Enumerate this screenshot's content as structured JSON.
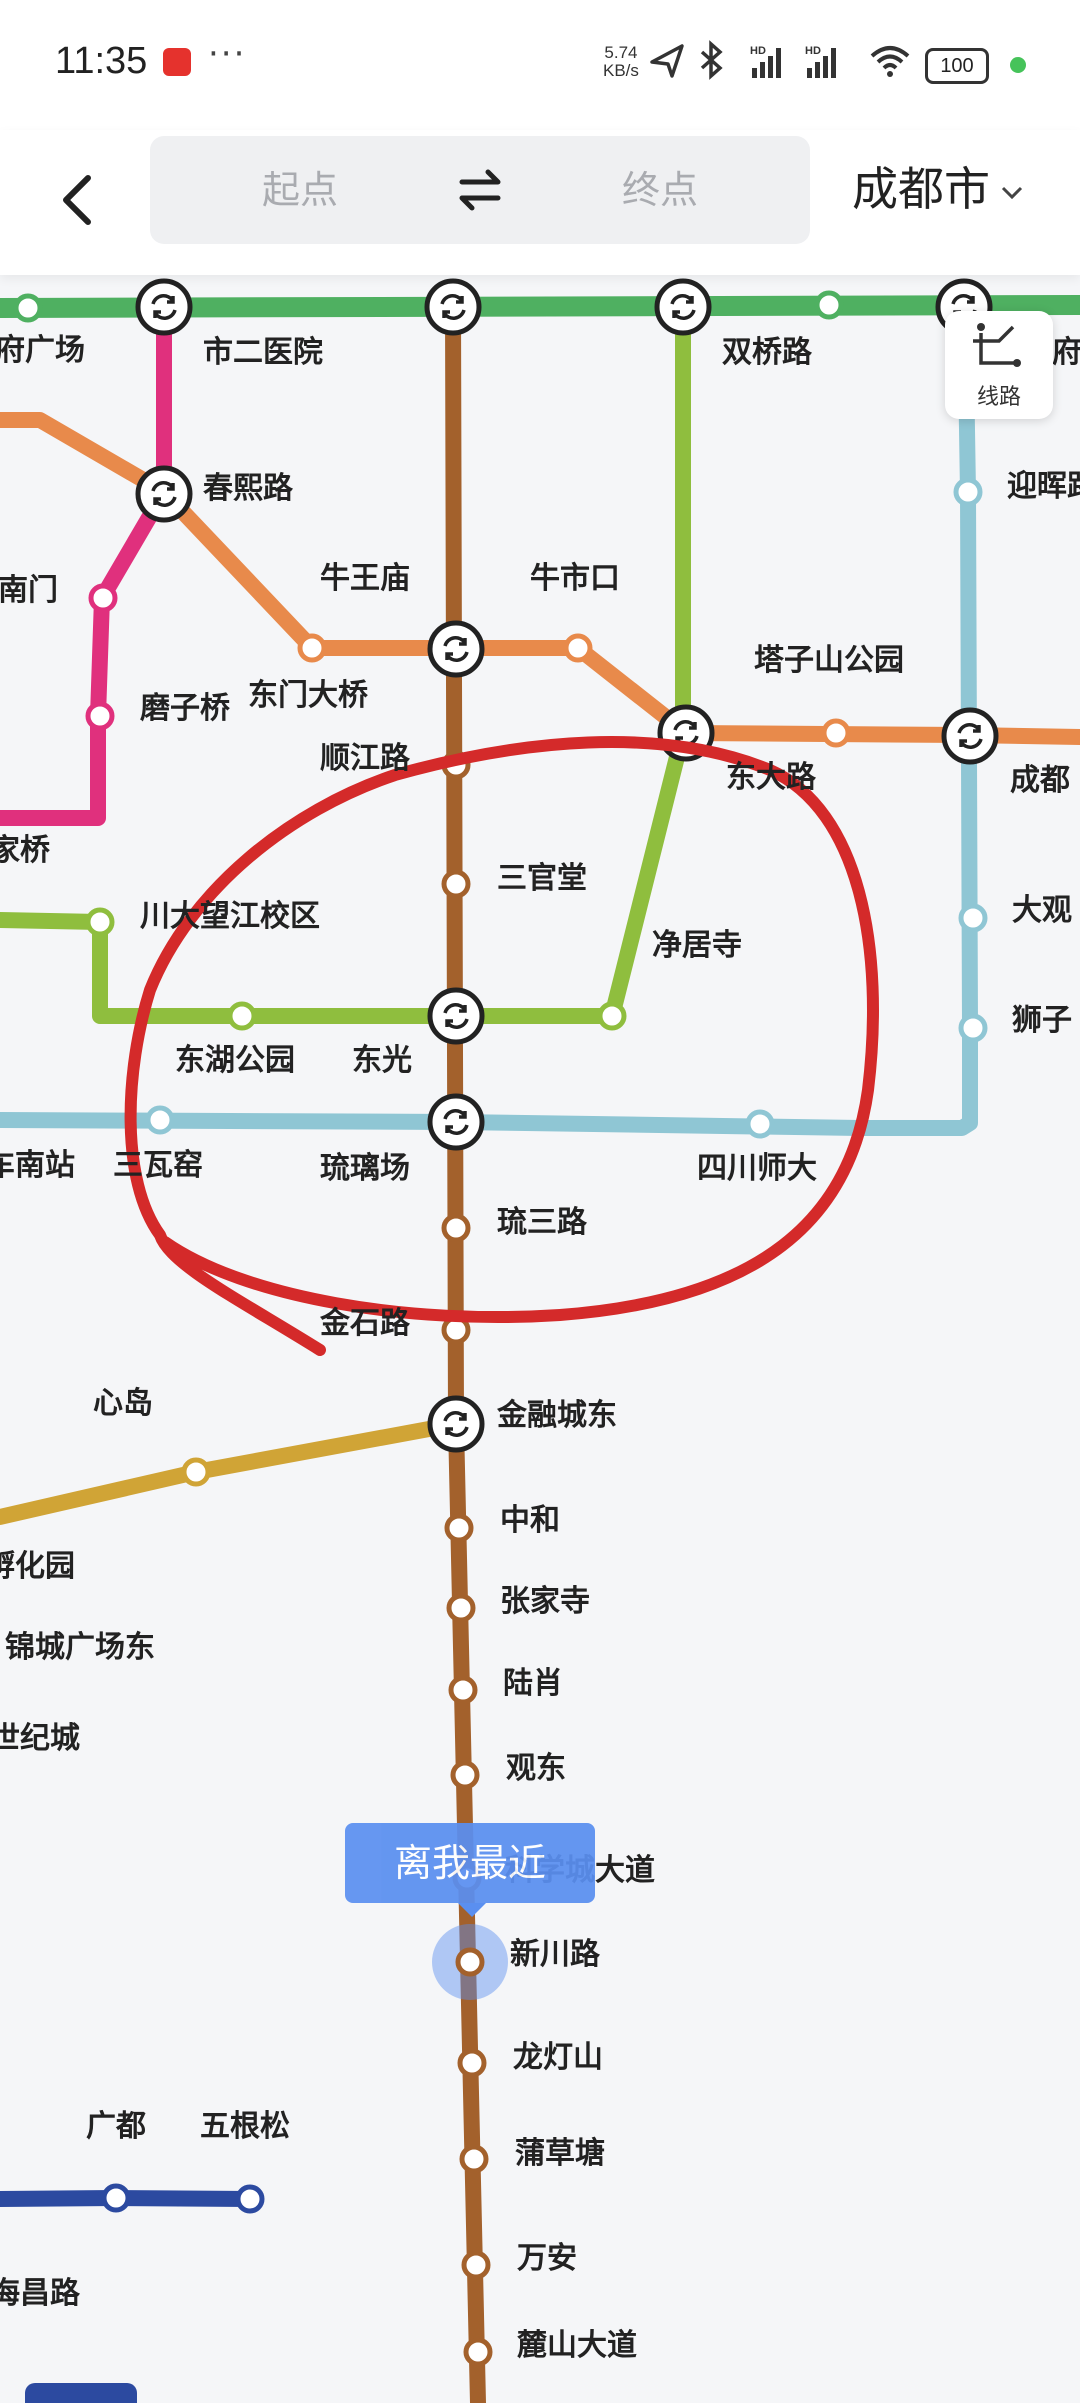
{
  "status_bar": {
    "time": "11:35",
    "net_speed_value": "5.74",
    "net_speed_unit": "KB/s",
    "battery": "100",
    "icons": [
      "app-notification-icon",
      "more-icon",
      "location-arrow-icon",
      "bluetooth-icon",
      "hd-signal-icon",
      "hd-signal-icon",
      "wifi-icon",
      "battery-icon"
    ]
  },
  "header": {
    "start_placeholder": "起点",
    "end_placeholder": "终点",
    "city": "成都市"
  },
  "line_button_label": "线路",
  "nearest_tip": "离我最近",
  "colors": {
    "brown_line": "#a3612c",
    "green_line_top": "#4fb061",
    "lime_line": "#8fbe3e",
    "orange_line": "#e88a4b",
    "pink_line": "#e0307d",
    "lightblue_line": "#8fc6d4",
    "gold_line": "#d0a436",
    "navy_line": "#2c4aa0",
    "annotation_red": "#d42a2a",
    "tip_blue": "#5a8ff0"
  },
  "stations": {
    "s01": "府广场",
    "s02": "市二医院",
    "s03": "双桥路",
    "s04": "府",
    "s05": "春熙路",
    "s06": "迎晖路",
    "s07": "南门",
    "s08": "牛王庙",
    "s09": "牛市口",
    "s10": "磨子桥",
    "s11": "东门大桥",
    "s12": "塔子山公园",
    "s13": "顺江路",
    "s14": "东大路",
    "s15": "成都",
    "s16": "家桥",
    "s17": "三官堂",
    "s18": "川大望江校区",
    "s19": "净居寺",
    "s20": "大观",
    "s21": "狮子",
    "s22": "东湖公园",
    "s23": "东光",
    "s24": "车南站",
    "s25": "三瓦窑",
    "s26": "琉璃场",
    "s27": "四川师大",
    "s28": "琉三路",
    "s29": "金石路",
    "s30": "心岛",
    "s31": "金融城东",
    "s32": "孵化园",
    "s33": "中和",
    "s34": "张家寺",
    "s35": "锦城广场东",
    "s36": "陆肖",
    "s37": "世纪城",
    "s38": "观东",
    "s39": "科学城大道",
    "s40": "新川路",
    "s41": "龙灯山",
    "s42": "广都",
    "s43": "五根松",
    "s44": "蒲草塘",
    "s45": "海昌路",
    "s46": "万安",
    "s47": "麓山大道"
  }
}
